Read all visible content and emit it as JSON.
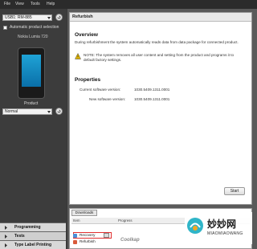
{
  "menu": [
    "File",
    "View",
    "Tools",
    "Help"
  ],
  "sidebar": {
    "device_combo": "USB1: RM-885",
    "auto_selection_label": "Automatic product selection",
    "device_name": "Nokia Lumia 720",
    "product_label": "Product",
    "product_combo": "Normal",
    "nav": [
      "Programming",
      "Tests",
      "Type Label Printing"
    ]
  },
  "panel": {
    "title": "Refurbish",
    "overview_heading": "Overview",
    "overview_text": "During refurbishment the system automatically reads data from data package for connected product.",
    "note_text": "NOTE: The system removes all user content and setting from the product and programs it to default factory settings.",
    "properties_heading": "Properties",
    "current_version_label": "Current software version:",
    "current_version_value": "1030.5409.1311.0001",
    "new_version_label": "New software version:",
    "new_version_value": "1030.5409.1311.0001",
    "start_button": "Start"
  },
  "downloads": {
    "tab": "Downloads",
    "col_item": "Item",
    "col_progress": "Progress",
    "rows": [
      "Recovery",
      "Refurbish"
    ]
  },
  "watermark": {
    "brand_cn": "妙妙网",
    "brand_en": "MIAOMIAOWANG",
    "left_mark": "Coolkap"
  },
  "colors": {
    "accent": "#4a8fd8",
    "highlight": "#e03030"
  }
}
